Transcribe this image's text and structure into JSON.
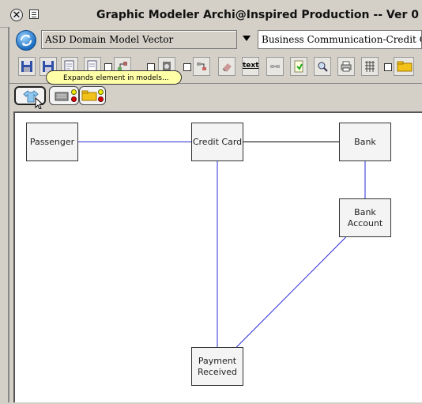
{
  "window": {
    "title": "Graphic Modeler Archi@Inspired Production -- Ver 0"
  },
  "selectors": {
    "domain": "ASD Domain Model Vector",
    "model": "Business Communication-Credit Car"
  },
  "toolbar": {
    "text_tool_label": "text"
  },
  "tooltip": {
    "text": "Expands element in models..."
  },
  "diagram": {
    "nodes": [
      {
        "id": "passenger",
        "label": "Passenger"
      },
      {
        "id": "credit-card",
        "label": "Credit Card"
      },
      {
        "id": "bank",
        "label": "Bank"
      },
      {
        "id": "bank-account",
        "label": "Bank\nAccount"
      },
      {
        "id": "payment-received",
        "label": "Payment\nReceived"
      }
    ],
    "edges": [
      {
        "from": "passenger",
        "to": "credit-card",
        "color": "#2a2ad8"
      },
      {
        "from": "credit-card",
        "to": "bank",
        "color": "#000000"
      },
      {
        "from": "bank",
        "to": "bank-account",
        "color": "#2a2ad8"
      },
      {
        "from": "credit-card",
        "to": "payment-received",
        "color": "#2a2ad8"
      },
      {
        "from": "bank-account",
        "to": "payment-received",
        "color": "#2a2ad8"
      }
    ]
  }
}
